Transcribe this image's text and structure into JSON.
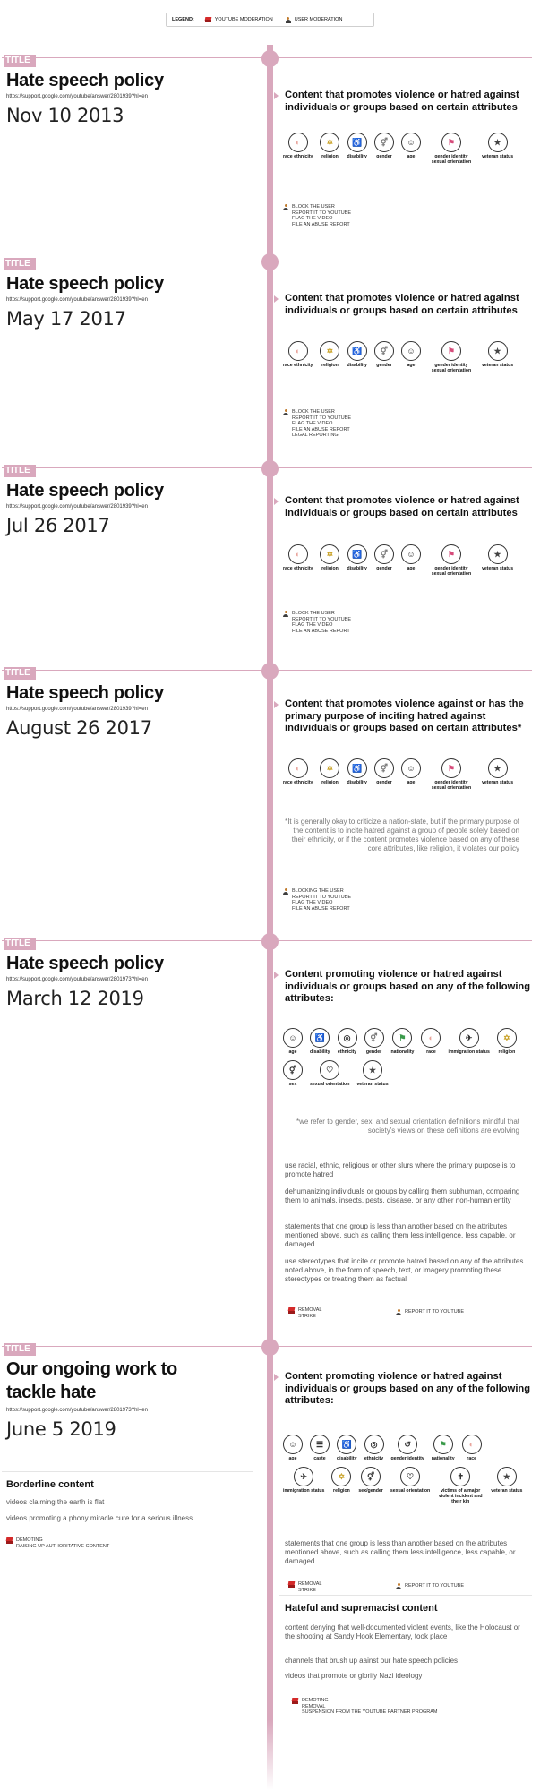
{
  "legend": {
    "title": "LEGEND:",
    "youtube": "YOUTUBE MODERATION",
    "user": "USER MODERATION"
  },
  "sections": [
    {
      "tag": "TITLE",
      "title": "Hate speech policy",
      "url": "https://support.google.com/youtube/answer/2801939?hl=en",
      "date": "Nov 10 2013",
      "heading": "Content that promotes violence or hatred against individuals or groups based on certain attributes",
      "attributes": [
        "race ethnicity",
        "religion",
        "disability",
        "gender",
        "age",
        "gender identity sexual orientation",
        "veteran status"
      ],
      "user_actions": [
        "BLOCK THE USER",
        "REPORT IT TO YOUTUBE",
        "FLAG THE VIDEO",
        "FILE AN ABUSE REPORT"
      ]
    },
    {
      "tag": "TITLE",
      "title": "Hate speech policy",
      "url": "https://support.google.com/youtube/answer/2801939?hl=en",
      "date": "May 17 2017",
      "heading": "Content that promotes violence or hatred against individuals or groups based on certain attributes",
      "attributes": [
        "race ethnicity",
        "religion",
        "disability",
        "gender",
        "age",
        "gender identity sexual orientation",
        "veteran status"
      ],
      "user_actions": [
        "BLOCK THE USER",
        "REPORT IT TO YOUTUBE",
        "FLAG THE VIDEO",
        "FILE AN ABUSE REPORT",
        "LEGAL REPORTING"
      ]
    },
    {
      "tag": "TITLE",
      "title": "Hate speech policy",
      "url": "https://support.google.com/youtube/answer/2801939?hl=en",
      "date": "Jul 26 2017",
      "heading": "Content that promotes violence or hatred against individuals or groups based on certain attributes",
      "attributes": [
        "race ethnicity",
        "religion",
        "disability",
        "gender",
        "age",
        "gender identity sexual orientation",
        "veteran status"
      ],
      "user_actions": [
        "BLOCK THE USER",
        "REPORT IT TO YOUTUBE",
        "FLAG THE VIDEO",
        "FILE AN ABUSE REPORT"
      ]
    },
    {
      "tag": "TITLE",
      "title": "Hate speech policy",
      "url": "https://support.google.com/youtube/answer/2801939?hl=en",
      "date": "August 26 2017",
      "heading": "Content that promotes violence against or has the primary purpose of inciting hatred against individuals or groups based on certain attributes*",
      "attributes": [
        "race ethnicity",
        "religion",
        "disability",
        "gender",
        "age",
        "gender identity sexual orientation",
        "veteran status"
      ],
      "note": "*It is generally okay to criticize a nation-state, but if the primary purpose of the content is to incite hatred against a group of people solely based on their ethnicity, or if the content promotes violence based on any of these core attributes, like religion, it violates our policy",
      "user_actions": [
        "BLOCKING THE USER",
        "REPORT IT TO YOUTUBE",
        "FLAG THE VIDEO",
        "FILE AN ABUSE REPORT"
      ]
    },
    {
      "tag": "TITLE",
      "title": "Hate speech policy",
      "url": "https://support.google.com/youtube/answer/2801973?hl=en",
      "date": "March 12 2019",
      "heading": "Content promoting violence or hatred against individuals or groups based on any of the following attributes:",
      "attributes": [
        "age",
        "disability",
        "ethnicity",
        "gender",
        "nationality",
        "race",
        "immigration status",
        "religion",
        "sex",
        "sexual orientation",
        "veteran status"
      ],
      "note": "*we refer to gender, sex, and sexual orientation definitions mindful that society's views on these definitions are evolving",
      "examples": [
        "use racial, ethnic, religious or other slurs where the primary purpose is to promote hatred",
        "dehumanizing individuals or groups by calling them subhuman, comparing them to animals, insects, pests, disease, or any other non-human entity",
        "statements that one group is less than another based on the attributes mentioned above, such as calling them less intelligence, less capable, or damaged",
        "use stereotypes that incite or promote hatred based on any of the attributes noted above, in the form of speech, text, or imagery promoting these stereotypes or treating them as factual"
      ],
      "yt_actions": [
        "REMOVAL",
        "STRIKE"
      ],
      "user_actions": [
        "REPORT IT TO YOUTUBE"
      ]
    },
    {
      "tag": "TITLE",
      "title": "Our ongoing work to tackle hate",
      "url": "https://support.google.com/youtube/answer/2801973?hl=en",
      "date": "June 5 2019",
      "heading": "Content promoting violence or hatred against individuals or groups based on any of the following attributes:",
      "attributes": [
        "age",
        "caste",
        "disability",
        "ethnicity",
        "gender identity",
        "nationality",
        "race",
        "immigration status",
        "religion",
        "sex/gender",
        "sexual orientation",
        "victims of a major violent incident and their kin",
        "veteran status"
      ],
      "borderline": {
        "title": "Borderline content",
        "items": [
          "videos claiming the earth is flat",
          "videos promoting a phony miracle cure for a serious illness"
        ],
        "yt_actions": [
          "DEMOTING",
          "RAISING UP AUTHORITATIVE CONTENT"
        ]
      },
      "examples": [
        "statements that one group is less than another based on the attributes mentioned above, such as calling them less intelligence, less capable, or damaged"
      ],
      "yt_actions": [
        "REMOVAL",
        "STRIKE"
      ],
      "user_actions": [
        "REPORT IT TO YOUTUBE"
      ],
      "supremacist": {
        "title": "Hateful and supremacist content",
        "items": [
          "content denying that well-documented violent events, like the Holocaust or the shooting at Sandy Hook Elementary, took place",
          "channels that brush up aainst our hate speech policies",
          "videos that promote or glorify Nazi ideology"
        ],
        "yt_actions": [
          "DEMOTING",
          "REMOVAL",
          "SUSPENSION FROM THE YOUTUBE PARTNER PROGRAM"
        ]
      }
    }
  ]
}
